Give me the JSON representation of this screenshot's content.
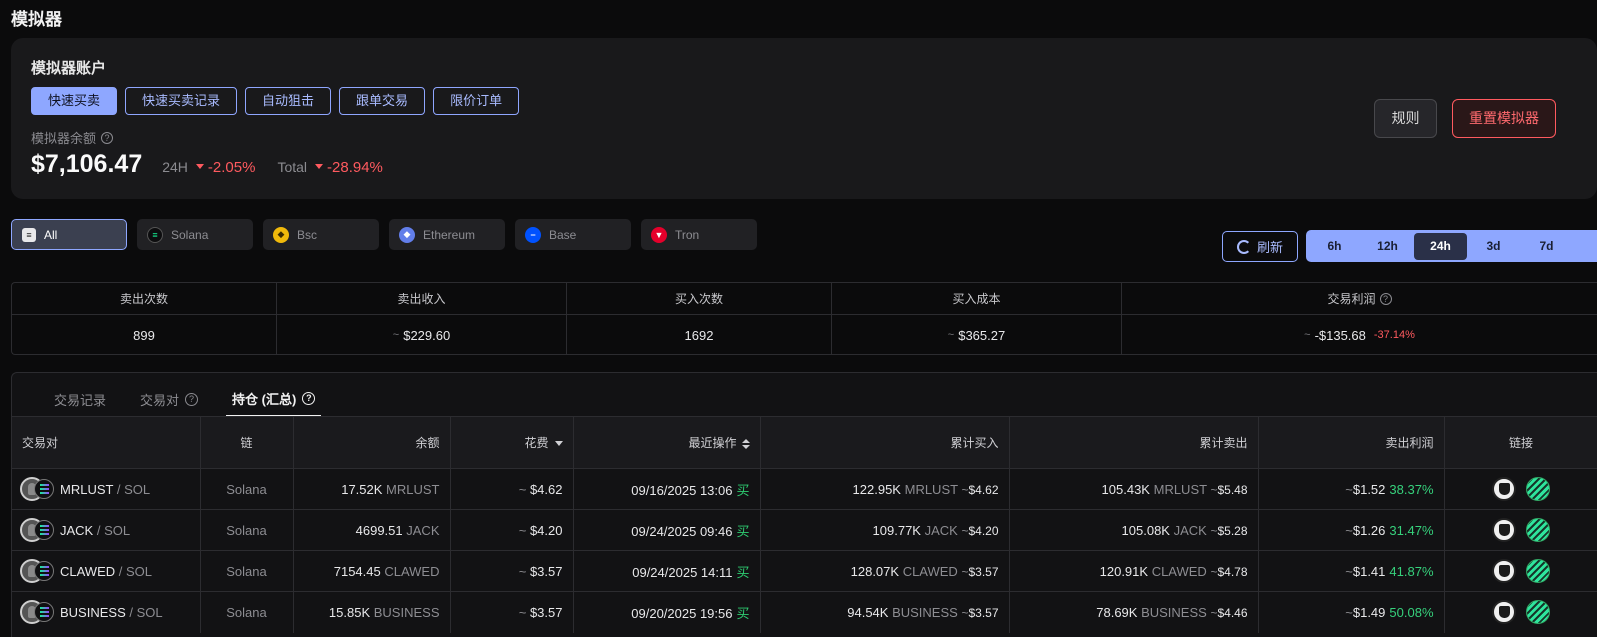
{
  "page": {
    "title": "模拟器"
  },
  "account": {
    "title": "模拟器账户",
    "mode_tabs": [
      "快速买卖",
      "快速买卖记录",
      "自动狙击",
      "跟单交易",
      "限价订单"
    ],
    "balance_label": "模拟器余额",
    "balance": "$7,106.47",
    "change_24h_label": "24H",
    "change_24h": "-2.05%",
    "change_total_label": "Total",
    "change_total": "-28.94%",
    "rules_label": "规则",
    "reset_label": "重置模拟器"
  },
  "chains": [
    {
      "label": "All",
      "icon": "layers-icon"
    },
    {
      "label": "Solana",
      "icon": "solana-icon"
    },
    {
      "label": "Bsc",
      "icon": "bsc-icon"
    },
    {
      "label": "Ethereum",
      "icon": "ethereum-icon"
    },
    {
      "label": "Base",
      "icon": "base-icon"
    },
    {
      "label": "Tron",
      "icon": "tron-icon"
    }
  ],
  "refresh_label": "刷新",
  "ranges": [
    "6h",
    "12h",
    "24h",
    "3d",
    "7d"
  ],
  "stats": {
    "headers": [
      "卖出次数",
      "卖出收入",
      "买入次数",
      "买入成本",
      "交易利润"
    ],
    "sell_count": "899",
    "sell_income": "$229.60",
    "buy_count": "1692",
    "buy_cost": "$365.27",
    "profit": "-$135.68",
    "profit_pct": "-37.14%"
  },
  "sub_tabs": [
    "交易记录",
    "交易对",
    "持仓 (汇总)"
  ],
  "table": {
    "headers": [
      "交易对",
      "链",
      "余额",
      "花费",
      "最近操作",
      "累计买入",
      "累计卖出",
      "卖出利润",
      "链接"
    ],
    "rows": [
      {
        "token": "MRLUST",
        "quote": "/ SOL",
        "chain": "Solana",
        "balance": "17.52K",
        "balance_unit": "MRLUST",
        "cost": "$4.62",
        "last_op": "09/16/2025 13:06",
        "op": "买",
        "buy_amt": "122.95K",
        "buy_unit": "MRLUST",
        "buy_usd": "$4.62",
        "sell_amt": "105.43K",
        "sell_unit": "MRLUST",
        "sell_usd": "$5.48",
        "profit": "$1.52",
        "profit_pct": "38.37%"
      },
      {
        "token": "JACK",
        "quote": "/ SOL",
        "chain": "Solana",
        "balance": "4699.51",
        "balance_unit": "JACK",
        "cost": "$4.20",
        "last_op": "09/24/2025 09:46",
        "op": "买",
        "buy_amt": "109.77K",
        "buy_unit": "JACK",
        "buy_usd": "$4.20",
        "sell_amt": "105.08K",
        "sell_unit": "JACK",
        "sell_usd": "$5.28",
        "profit": "$1.26",
        "profit_pct": "31.47%"
      },
      {
        "token": "CLAWED",
        "quote": "/ SOL",
        "chain": "Solana",
        "balance": "7154.45",
        "balance_unit": "CLAWED",
        "cost": "$3.57",
        "last_op": "09/24/2025 14:11",
        "op": "买",
        "buy_amt": "128.07K",
        "buy_unit": "CLAWED",
        "buy_usd": "$3.57",
        "sell_amt": "120.91K",
        "sell_unit": "CLAWED",
        "sell_usd": "$4.78",
        "profit": "$1.41",
        "profit_pct": "41.87%"
      },
      {
        "token": "BUSINESS",
        "quote": "/ SOL",
        "chain": "Solana",
        "balance": "15.85K",
        "balance_unit": "BUSINESS",
        "cost": "$3.57",
        "last_op": "09/20/2025 19:56",
        "op": "买",
        "buy_amt": "94.54K",
        "buy_unit": "BUSINESS",
        "buy_usd": "$3.57",
        "sell_amt": "78.69K",
        "sell_unit": "BUSINESS",
        "sell_usd": "$4.46",
        "profit": "$1.49",
        "profit_pct": "50.08%"
      }
    ]
  },
  "tilde": "~",
  "colors": {
    "accent": "#8ea7ff",
    "negative": "#ff5a5f",
    "positive": "#36d17c"
  }
}
